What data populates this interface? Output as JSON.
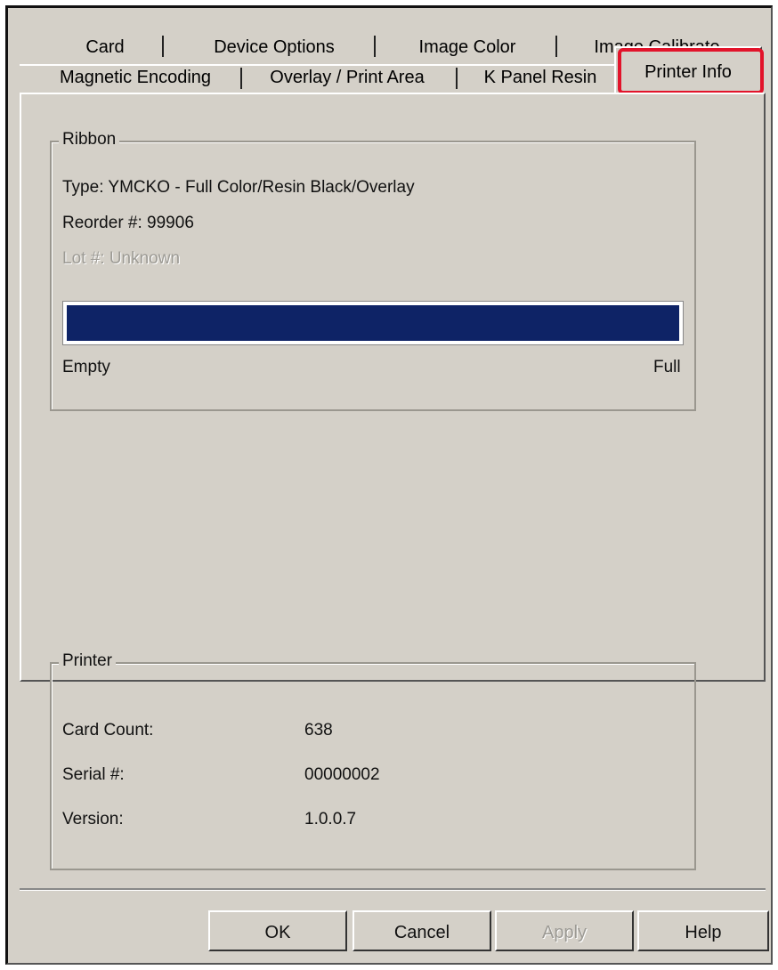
{
  "tabs": {
    "row1": [
      "Card",
      "Device Options",
      "Image Color",
      "Image Calibrate"
    ],
    "row2": [
      "Magnetic Encoding",
      "Overlay / Print Area",
      "K Panel Resin",
      "Printer Info"
    ],
    "active": "Printer Info"
  },
  "ribbon": {
    "legend": "Ribbon",
    "type": "Type: YMCKO - Full Color/Resin Black/Overlay",
    "reorder": "Reorder #: 99906",
    "lot": "Lot #: Unknown",
    "level_percent": 100,
    "empty_label": "Empty",
    "full_label": "Full",
    "bar_color": "#0e2366"
  },
  "printer": {
    "legend": "Printer",
    "rows": [
      {
        "label": "Card Count:",
        "value": "638"
      },
      {
        "label": "Serial #:",
        "value": "00000002"
      },
      {
        "label": "Version:",
        "value": "1.0.0.7"
      }
    ]
  },
  "buttons": {
    "ok": "OK",
    "cancel": "Cancel",
    "apply": "Apply",
    "help": "Help"
  },
  "highlight_color": "#e2132a"
}
